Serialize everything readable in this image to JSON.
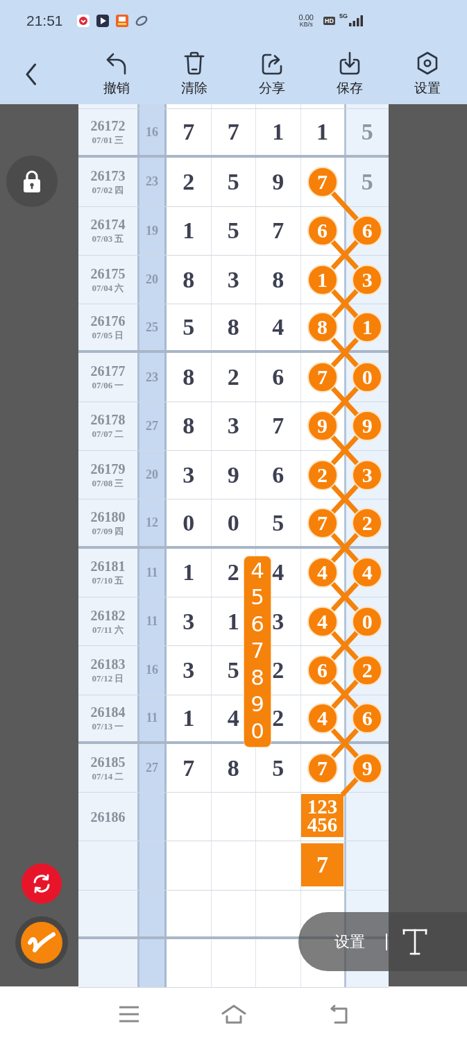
{
  "status_bar": {
    "time": "21:51",
    "net_speed": "0.00",
    "net_unit": "KB/s",
    "hd": "HD",
    "network": "5G"
  },
  "toolbar": {
    "buttons": [
      {
        "kind": "undo",
        "label": "撤销"
      },
      {
        "kind": "clear",
        "label": "清除"
      },
      {
        "kind": "share",
        "label": "分享"
      },
      {
        "kind": "save",
        "label": "保存"
      },
      {
        "kind": "settings",
        "label": "设置"
      }
    ]
  },
  "table": {
    "rows": [
      {
        "issue": "26172",
        "date": "07/01 三",
        "sum": "16",
        "digits": [
          "7",
          "7",
          "1"
        ],
        "digit_4": {
          "kind": "plain",
          "text": "1"
        },
        "column_7": {
          "kind": "plain",
          "text": "5"
        }
      },
      {
        "issue": "26173",
        "date": "07/02 四",
        "sum": "23",
        "digits": [
          "2",
          "5",
          "9"
        ],
        "digit_4": {
          "kind": "ball",
          "text": "7"
        },
        "column_7": {
          "kind": "plain",
          "text": "5"
        }
      },
      {
        "issue": "26174",
        "date": "07/03 五",
        "sum": "19",
        "digits": [
          "1",
          "5",
          "7"
        ],
        "digit_4": {
          "kind": "ball",
          "text": "6"
        },
        "column_7": {
          "kind": "ball",
          "text": "6"
        }
      },
      {
        "issue": "26175",
        "date": "07/04 六",
        "sum": "20",
        "digits": [
          "8",
          "3",
          "8"
        ],
        "digit_4": {
          "kind": "ball",
          "text": "1"
        },
        "column_7": {
          "kind": "ball",
          "text": "3"
        }
      },
      {
        "issue": "26176",
        "date": "07/05 日",
        "sum": "25",
        "digits": [
          "5",
          "8",
          "4"
        ],
        "digit_4": {
          "kind": "ball",
          "text": "8"
        },
        "column_7": {
          "kind": "ball",
          "text": "1"
        }
      },
      {
        "issue": "26177",
        "date": "07/06 一",
        "sum": "23",
        "digits": [
          "8",
          "2",
          "6"
        ],
        "digit_4": {
          "kind": "ball",
          "text": "7"
        },
        "column_7": {
          "kind": "ball",
          "text": "0"
        }
      },
      {
        "issue": "26178",
        "date": "07/07 二",
        "sum": "27",
        "digits": [
          "8",
          "3",
          "7"
        ],
        "digit_4": {
          "kind": "ball",
          "text": "9"
        },
        "column_7": {
          "kind": "ball",
          "text": "9"
        }
      },
      {
        "issue": "26179",
        "date": "07/08 三",
        "sum": "20",
        "digits": [
          "3",
          "9",
          "6"
        ],
        "digit_4": {
          "kind": "ball",
          "text": "2"
        },
        "column_7": {
          "kind": "ball",
          "text": "3"
        }
      },
      {
        "issue": "26180",
        "date": "07/09 四",
        "sum": "12",
        "digits": [
          "0",
          "0",
          "5"
        ],
        "digit_4": {
          "kind": "ball",
          "text": "7"
        },
        "column_7": {
          "kind": "ball",
          "text": "2"
        }
      },
      {
        "issue": "26181",
        "date": "07/10 五",
        "sum": "11",
        "digits": [
          "1",
          "2",
          "4"
        ],
        "digit_4": {
          "kind": "ball",
          "text": "4"
        },
        "column_7": {
          "kind": "ball",
          "text": "4"
        },
        "strip": "4567890"
      },
      {
        "issue": "26182",
        "date": "07/11 六",
        "sum": "11",
        "digits": [
          "3",
          "1",
          "3"
        ],
        "digit_4": {
          "kind": "ball",
          "text": "4"
        },
        "column_7": {
          "kind": "ball",
          "text": "0"
        }
      },
      {
        "issue": "26183",
        "date": "07/12 日",
        "sum": "16",
        "digits": [
          "3",
          "5",
          "2"
        ],
        "digit_4": {
          "kind": "ball",
          "text": "6"
        },
        "column_7": {
          "kind": "ball",
          "text": "2"
        }
      },
      {
        "issue": "26184",
        "date": "07/13 一",
        "sum": "11",
        "digits": [
          "1",
          "4",
          "2"
        ],
        "digit_4": {
          "kind": "ball",
          "text": "4"
        },
        "column_7": {
          "kind": "ball",
          "text": "6"
        }
      },
      {
        "issue": "26185",
        "date": "07/14 二",
        "sum": "27",
        "digits": [
          "7",
          "8",
          "5"
        ],
        "digit_4": {
          "kind": "ball",
          "text": "7"
        },
        "column_7": {
          "kind": "ball",
          "text": "9"
        }
      },
      {
        "issue": "26186",
        "digit_4": {
          "kind": "box",
          "lines": [
            "123",
            "456"
          ]
        }
      },
      {
        "digit_4": {
          "kind": "box",
          "lines": [
            "7"
          ]
        }
      }
    ]
  },
  "floating_toolbar": {
    "label": "设置"
  }
}
